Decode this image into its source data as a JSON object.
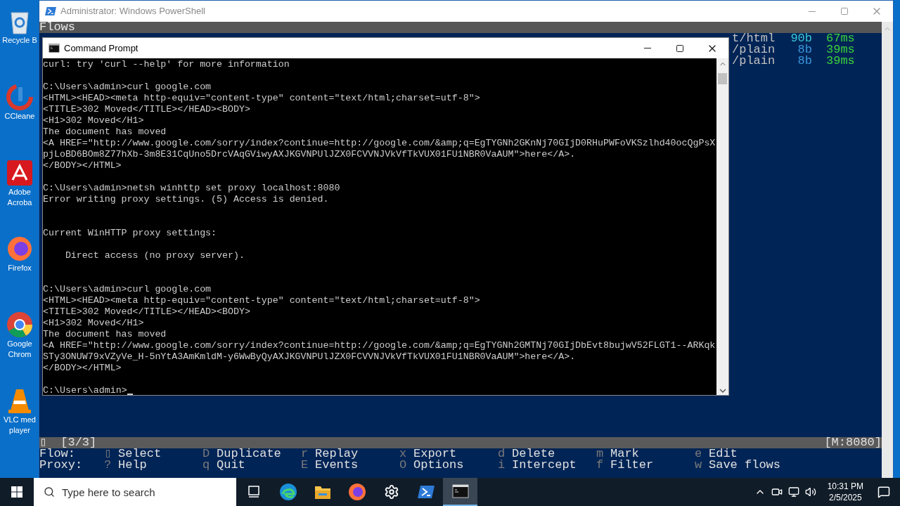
{
  "desktop": {
    "icons": [
      {
        "kind": "recycle-bin",
        "lines": [
          "Recycle B"
        ]
      },
      {
        "kind": "cleaner",
        "lines": [
          "CCleane"
        ]
      },
      {
        "kind": "acrobat",
        "lines": [
          "Adobe",
          "Acroba"
        ]
      },
      {
        "kind": "firefox",
        "lines": [
          "Firefox"
        ]
      },
      {
        "kind": "chrome",
        "lines": [
          "Google",
          "Chrom"
        ]
      },
      {
        "kind": "vlc",
        "lines": [
          "VLC med",
          "player"
        ]
      }
    ]
  },
  "powershell": {
    "title": "Administrator: Windows PowerShell",
    "header": "Flows",
    "flows": [
      {
        "content_type": "t/html",
        "size": "90b",
        "color": "#3ac8d8",
        "duration": "67ms"
      },
      {
        "content_type": "/plain",
        "size": "8b",
        "color": "#3a96dd",
        "duration": "39ms"
      },
      {
        "content_type": "/plain",
        "size": "8b",
        "color": "#3a96dd",
        "duration": "39ms"
      }
    ],
    "status": {
      "marker": "▯",
      "count": "[3/3]",
      "listen": "[M:8080]"
    },
    "keybindings": [
      {
        "label": "Flow:",
        "keys": [
          {
            "key": "▯",
            "action": "Select"
          },
          {
            "key": "D",
            "action": "Duplicate"
          },
          {
            "key": "r",
            "action": "Replay"
          },
          {
            "key": "x",
            "action": "Export"
          },
          {
            "key": "d",
            "action": "Delete"
          },
          {
            "key": "m",
            "action": "Mark"
          },
          {
            "key": "e",
            "action": "Edit"
          }
        ]
      },
      {
        "label": "Proxy:",
        "keys": [
          {
            "key": "?",
            "action": "Help"
          },
          {
            "key": "q",
            "action": "Quit"
          },
          {
            "key": "E",
            "action": "Events"
          },
          {
            "key": "O",
            "action": "Options"
          },
          {
            "key": "i",
            "action": "Intercept"
          },
          {
            "key": "f",
            "action": "Filter"
          },
          {
            "key": "w",
            "action": "Save flows"
          }
        ]
      }
    ]
  },
  "command_prompt": {
    "title": "Command Prompt",
    "lines": [
      {
        "kind": "text",
        "text": "curl: try 'curl --help' for more information"
      },
      {
        "kind": "blank"
      },
      {
        "kind": "text",
        "text": "C:\\Users\\admin>curl google.com"
      },
      {
        "kind": "text",
        "text": "<HTML><HEAD><meta http-equiv=\"content-type\" content=\"text/html;charset=utf-8\">"
      },
      {
        "kind": "text",
        "text": "<TITLE>302 Moved</TITLE></HEAD><BODY>"
      },
      {
        "kind": "text",
        "text": "<H1>302 Moved</H1>"
      },
      {
        "kind": "text",
        "text": "The document has moved"
      },
      {
        "kind": "text",
        "text": "<A HREF=\"http://www.google.com/sorry/index?continue=http://google.com/&amp;q=EgTYGNh2GKnNj70GIjD0RHuPWFoVKSzlhd40ocQgPsX"
      },
      {
        "kind": "text",
        "text": "pjLoBD6BOm8Z77hXb-3m8E31CqUno5DrcVAqGViwyAXJKGVNPUlJZX0FCVVNJVkVfTkVUX01FU1NBR0VaAUM\">here</A>."
      },
      {
        "kind": "text",
        "text": "</BODY></HTML>"
      },
      {
        "kind": "blank"
      },
      {
        "kind": "text",
        "text": "C:\\Users\\admin>netsh winhttp set proxy localhost:8080"
      },
      {
        "kind": "text",
        "text": "Error writing proxy settings. (5) Access is denied."
      },
      {
        "kind": "blank"
      },
      {
        "kind": "blank"
      },
      {
        "kind": "text",
        "text": "Current WinHTTP proxy settings:"
      },
      {
        "kind": "blank"
      },
      {
        "kind": "text",
        "text": "    Direct access (no proxy server)."
      },
      {
        "kind": "blank"
      },
      {
        "kind": "blank"
      },
      {
        "kind": "text",
        "text": "C:\\Users\\admin>curl google.com"
      },
      {
        "kind": "text",
        "text": "<HTML><HEAD><meta http-equiv=\"content-type\" content=\"text/html;charset=utf-8\">"
      },
      {
        "kind": "text",
        "text": "<TITLE>302 Moved</TITLE></HEAD><BODY>"
      },
      {
        "kind": "text",
        "text": "<H1>302 Moved</H1>"
      },
      {
        "kind": "text",
        "text": "The document has moved"
      },
      {
        "kind": "text",
        "text": "<A HREF=\"http://www.google.com/sorry/index?continue=http://google.com/&amp;q=EgTYGNh2GMTNj70GIjDbEvt8bujwV52FLGT1--ARKqk"
      },
      {
        "kind": "text",
        "text": "STy3ONUW79xVZyVe_H-5nYtA3AmKmldM-y6WwByQyAXJKGVNPUlJZX0FCVVNJVkVfTkVUX01FU1NBR0VaAUM\">here</A>."
      },
      {
        "kind": "text",
        "text": "</BODY></HTML>"
      },
      {
        "kind": "blank"
      },
      {
        "kind": "prompt",
        "text": "C:\\Users\\admin>"
      }
    ]
  },
  "taskbar": {
    "search_placeholder": "Type here to search",
    "apps": [
      {
        "kind": "task-view",
        "selected": false
      },
      {
        "kind": "edge",
        "selected": false
      },
      {
        "kind": "explorer",
        "selected": false
      },
      {
        "kind": "firefox",
        "selected": false
      },
      {
        "kind": "settings",
        "selected": false
      },
      {
        "kind": "powershell",
        "selected": false
      },
      {
        "kind": "cmd",
        "selected": true
      }
    ],
    "time": "10:31 PM",
    "date": "2/5/2025"
  }
}
